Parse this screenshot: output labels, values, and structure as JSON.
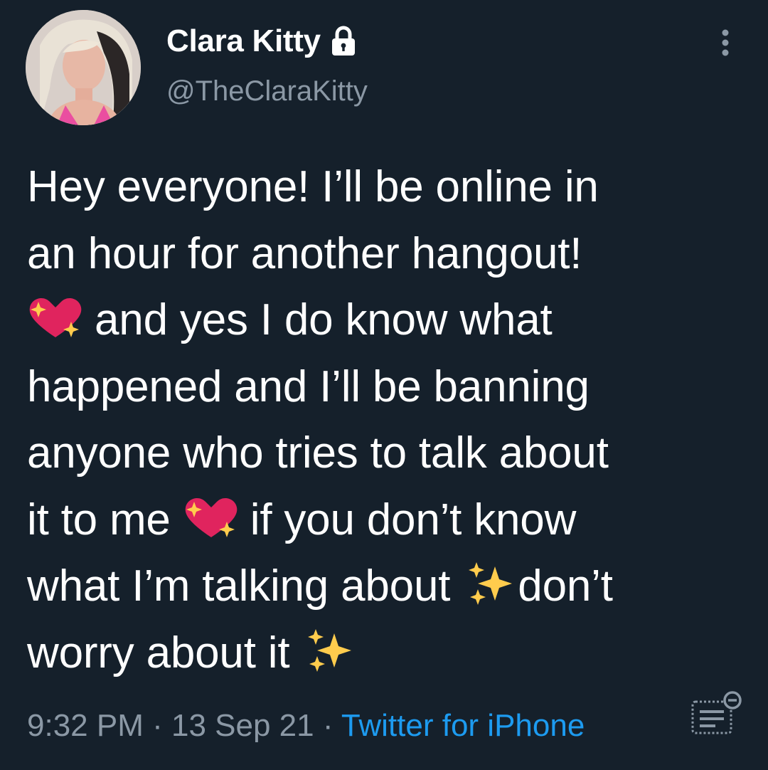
{
  "user": {
    "display_name": "Clara Kitty",
    "handle": "@TheClaraKitty",
    "protected_icon": "lock-icon",
    "avatar": "profile-photo"
  },
  "tweet": {
    "line1": "Hey everyone! I’ll be online in",
    "line2": "an hour for another hangout!",
    "line3_text": " and yes I do know what",
    "line4": "happened and I’ll be banning",
    "line5": "anyone who tries to talk about",
    "line6_a": "it to me ",
    "line6_b": " if you don’t know",
    "line7_a": "what I’m talking about ",
    "line7_b": "don’t",
    "line8_a": "worry about it ",
    "emojis": [
      "sparkling-heart",
      "sparkling-heart",
      "sparkles",
      "sparkles"
    ]
  },
  "meta": {
    "time": "9:32 PM",
    "sep1": " · ",
    "date": "13 Sep 21",
    "sep2": " · ",
    "source": "Twitter for iPhone"
  },
  "icons": {
    "more": "more-vertical-icon",
    "analytics": "analytics-icon"
  },
  "colors": {
    "background": "#15202b",
    "text": "#ffffff",
    "secondary": "#8b98a5",
    "link": "#1d9bf0"
  }
}
